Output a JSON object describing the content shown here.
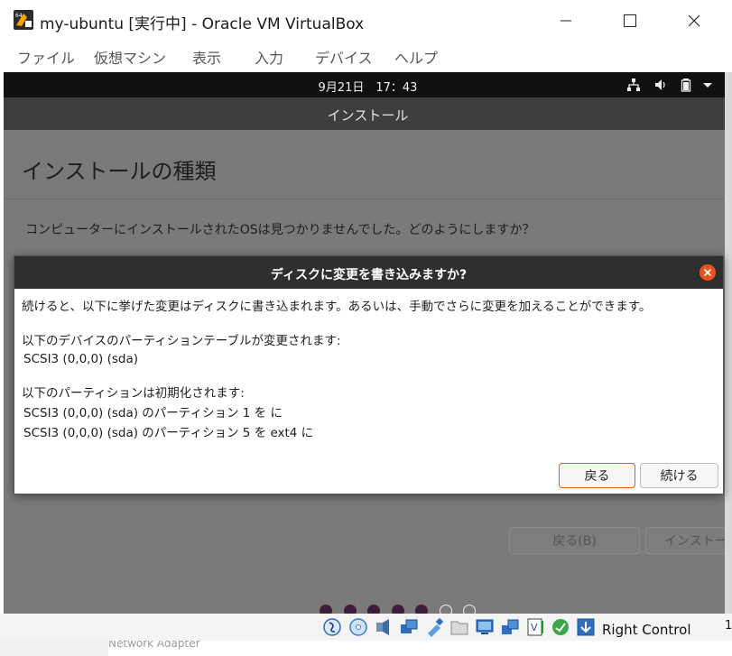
{
  "window": {
    "title": "my-ubuntu [実行中] - Oracle VM VirtualBox"
  },
  "menu": {
    "items": [
      "ファイル",
      "仮想マシン",
      "表示",
      "入力",
      "デバイス",
      "ヘルプ"
    ]
  },
  "guest": {
    "clock": "9月21日　17：43",
    "tray_icons": [
      "network-icon",
      "volume-icon",
      "battery-icon",
      "chevron-down-icon"
    ],
    "installer_title": "インストール",
    "page_title": "インストールの種類",
    "question": "コンピューターにインストールされたOSは見つかりませんでした。どのようにしますか？",
    "background_buttons": {
      "back": "戻る(B)",
      "install": "インストー"
    },
    "progress_steps": {
      "completed": 5,
      "total": 7
    }
  },
  "dialog": {
    "title": "ディスクに変更を書き込みますか?",
    "lines": [
      "続けると、以下に挙げた変更はディスクに書き込まれます。あるいは、手動でさらに変更を加えることができます。",
      "以下のデバイスのパーティションテーブルが変更されます:",
      "SCSI3 (0,0,0) (sda)",
      "以下のパーティションは初期化されます:",
      "SCSI3 (0,0,0) (sda) のパーティション 1 を に",
      "SCSI3 (0,0,0) (sda) のパーティション 5 を ext4 に"
    ],
    "buttons": {
      "back": "戻る",
      "continue": "続ける"
    },
    "accent_color": "#e95420"
  },
  "statusbar": {
    "host_key": "Right Control",
    "edge_digit": "1",
    "background_text": "Network Adapter"
  }
}
